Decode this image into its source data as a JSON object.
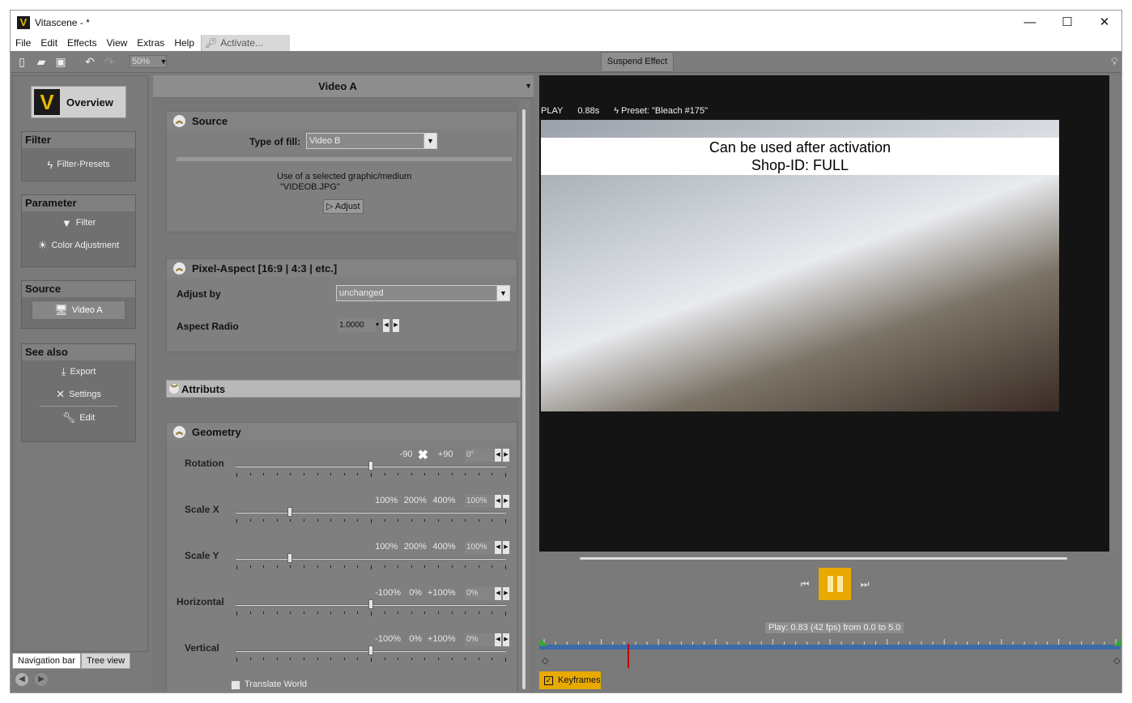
{
  "window": {
    "title": "Vitascene - *",
    "app_icon_letter": "V",
    "controls": {
      "minimize": "—",
      "maximize": "☐",
      "close": "✕"
    }
  },
  "menu": {
    "items": [
      "File",
      "Edit",
      "Effects",
      "View",
      "Extras",
      "Help"
    ],
    "activate": "Activate..."
  },
  "toolbar": {
    "zoom": "50%",
    "suspend_effect": "Suspend Effect"
  },
  "nav": {
    "overview": "Overview",
    "groups": [
      {
        "title": "Filter",
        "items": [
          {
            "label": "Filter-Presets",
            "icon": "lightning-icon"
          }
        ]
      },
      {
        "title": "Parameter",
        "items": [
          {
            "label": "Filter",
            "icon": "funnel-icon"
          },
          {
            "label": "Color Adjustment",
            "icon": "sun-icon"
          }
        ]
      },
      {
        "title": "Source",
        "items": [
          {
            "label": "Video A",
            "icon": "monitor-icon"
          }
        ]
      },
      {
        "title": "See also",
        "items": [
          {
            "label": "Export",
            "icon": "download-icon"
          },
          {
            "label": "Settings",
            "icon": "tools-icon"
          },
          {
            "label": "Edit",
            "icon": "wrench-icon"
          }
        ]
      }
    ],
    "tabs": [
      "Navigation bar",
      "Tree view"
    ]
  },
  "panel": {
    "title": "Video A",
    "source": {
      "heading": "Source",
      "type_of_fill_label": "Type of fill:",
      "type_of_fill_value": "Video B",
      "info_line1": "Use of a selected graphic/medium",
      "info_line2": "\"VIDEOB.JPG\"",
      "adjust": "Adjust"
    },
    "pixel_aspect": {
      "heading": "Pixel-Aspect [16:9 | 4:3 | etc.]",
      "adjust_by_label": "Adjust by",
      "adjust_by_value": "unchanged",
      "aspect_radio_label": "Aspect Radio",
      "aspect_radio_value": "1.0000"
    },
    "attributs": {
      "heading": "Attributs"
    },
    "geometry": {
      "heading": "Geometry",
      "rows": [
        {
          "label": "Rotation",
          "presets": [
            "-90",
            "+90"
          ],
          "value": "0°",
          "level": 0.5
        },
        {
          "label": "Scale X",
          "presets": [
            "100%",
            "200%",
            "400%"
          ],
          "value": "100%",
          "level": 0.2
        },
        {
          "label": "Scale Y",
          "presets": [
            "100%",
            "200%",
            "400%"
          ],
          "value": "100%",
          "level": 0.2
        },
        {
          "label": "Horizontal",
          "presets": [
            "-100%",
            "0%",
            "+100%"
          ],
          "value": "0%",
          "level": 0.5
        },
        {
          "label": "Vertical",
          "presets": [
            "-100%",
            "0%",
            "+100%"
          ],
          "value": "0%",
          "level": 0.5
        }
      ],
      "translate_world": "Translate World"
    }
  },
  "preview": {
    "state": "PLAY",
    "time": "0.88s",
    "preset": "Preset: \"Bleach #175\"",
    "banner_line1": "Can be used after activation",
    "banner_line2": "Shop-ID:  FULL"
  },
  "transport": {
    "play_status": "Play: 0.83 (42 fps) from 0.0 to 5.0",
    "keyframes": "Keyframes",
    "timeline_progress": 0.152
  },
  "colors": {
    "accent": "#e8a900",
    "timeline": "#3d6aa8",
    "cursor": "#c00000"
  }
}
